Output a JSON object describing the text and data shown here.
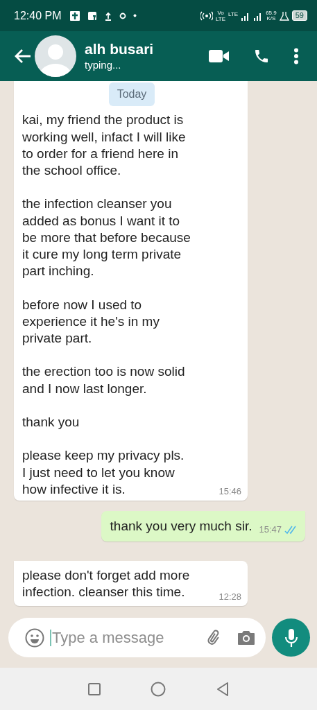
{
  "status_bar": {
    "time": "12:40 PM",
    "network_vo": "Vo",
    "network_vo_sub": "LTE",
    "network_lte": "LTE",
    "speed": "65.9",
    "speed_unit": "K/S",
    "battery": "59"
  },
  "header": {
    "contact_name": "alh busari",
    "status": "typing..."
  },
  "date_chip": "Today",
  "messages": [
    {
      "kind": "incoming",
      "text": "kai, my friend the product is\nworking well, infact I will like\nto order for a friend here in\nthe school office.\n\nthe infection cleanser you\nadded as bonus I want it to\nbe more that before because\nit cure my long term private\npart inching.\n\nbefore now I used to\nexperience it he's in my\nprivate part.\n\nthe erection too is now solid\nand I now last longer.\n\nthank you\n\nplease keep my privacy pls.\nI just need to let you know\nhow infective it is.",
      "time": "15:46",
      "tail": false
    },
    {
      "kind": "outgoing",
      "text": "thank you very much sir.",
      "time": "15:47",
      "read": true,
      "tail": true
    },
    {
      "kind": "incoming",
      "text": "please don't forget add more\ninfection. cleanser this time.",
      "time": "12:28",
      "tail": true
    }
  ],
  "composer": {
    "placeholder": "Type a message"
  }
}
